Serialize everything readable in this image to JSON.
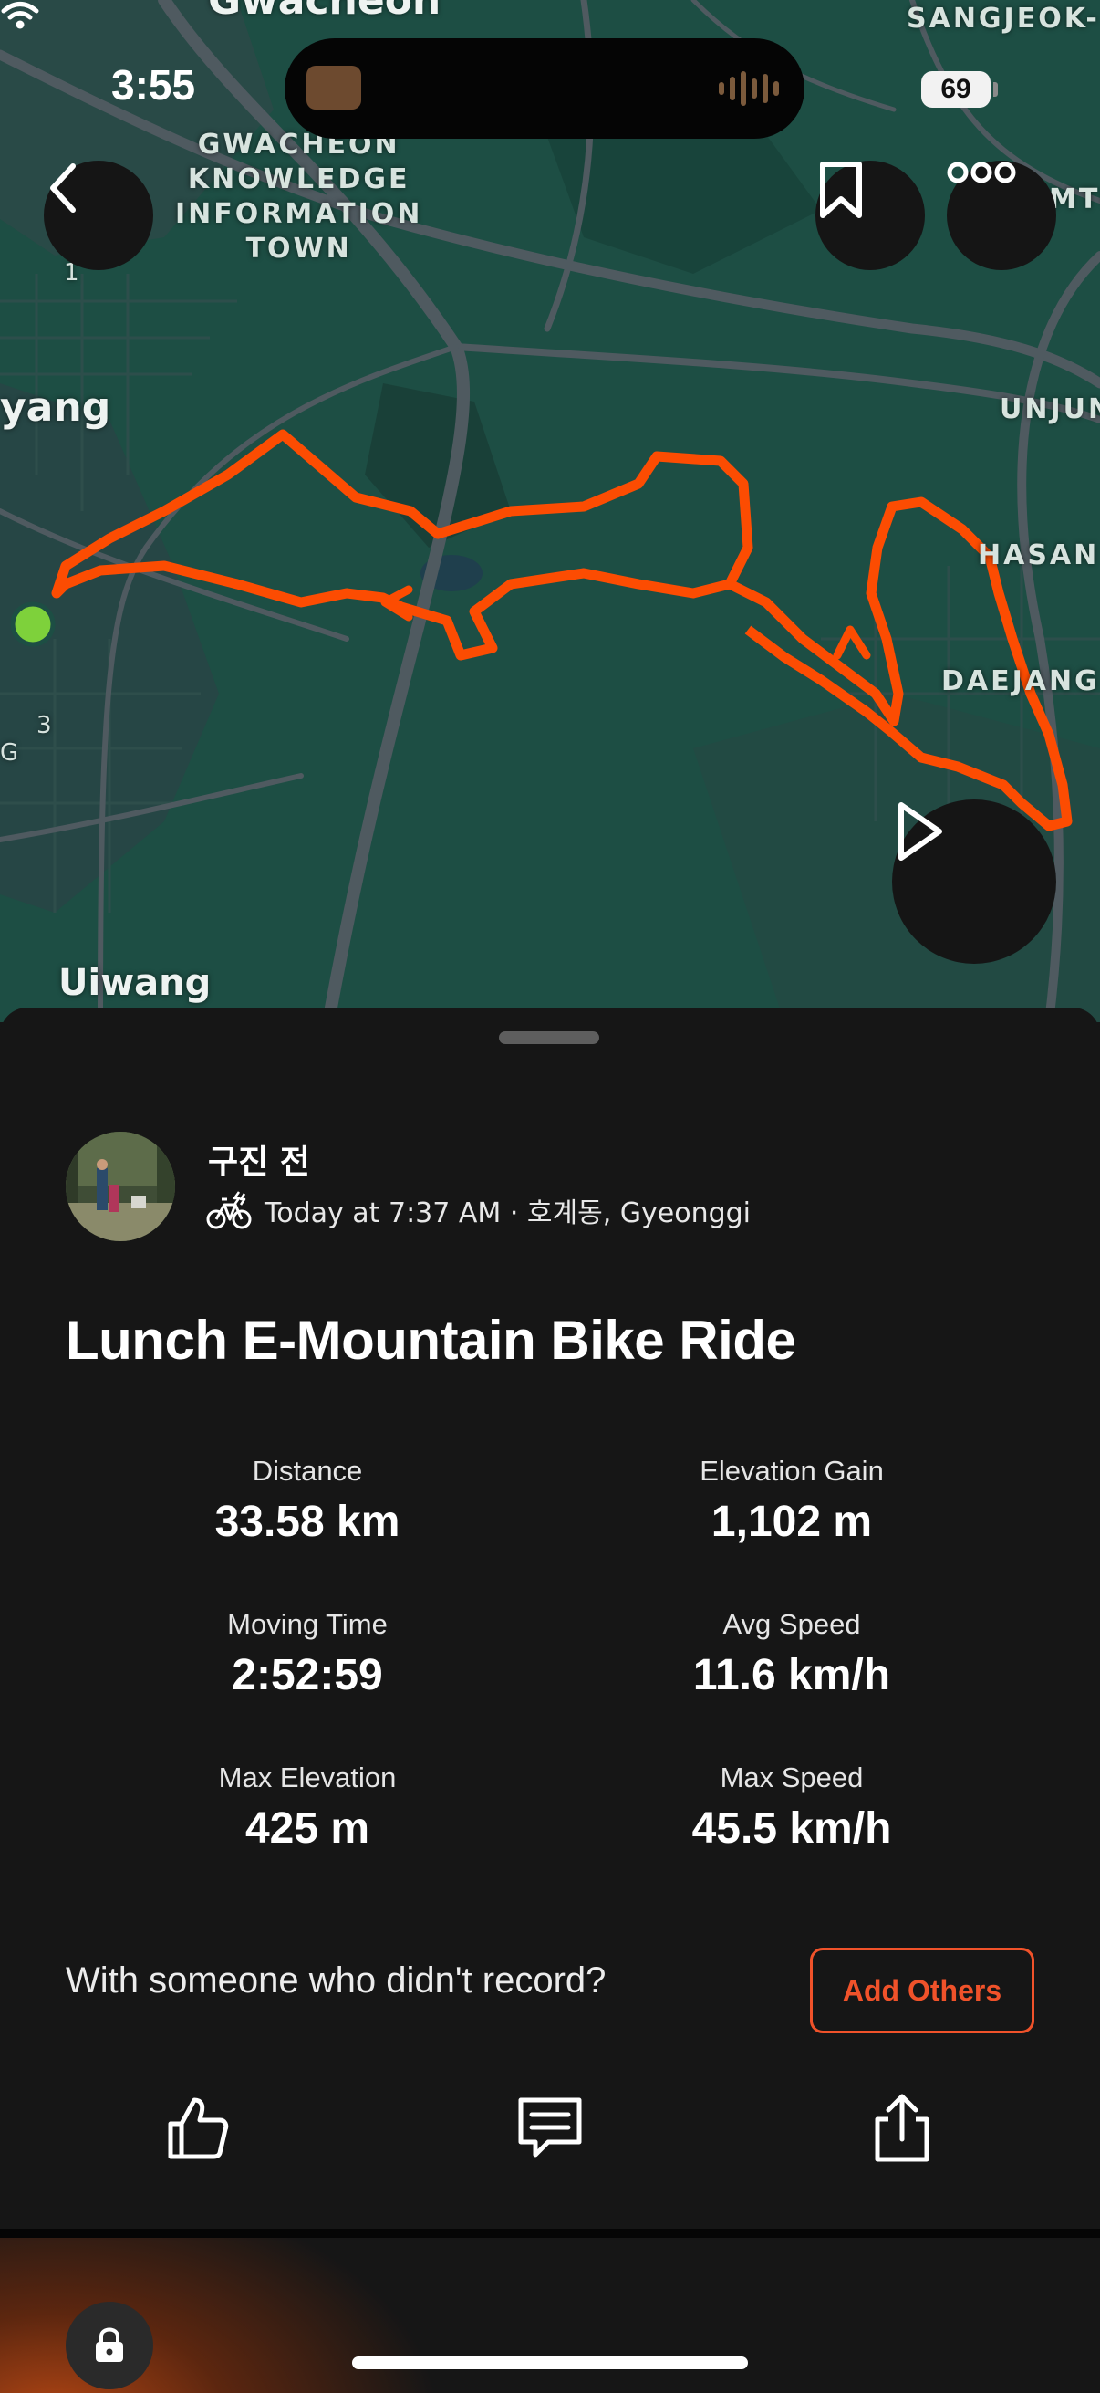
{
  "status_bar": {
    "time": "3:55",
    "battery": "69"
  },
  "map": {
    "labels": {
      "gwacheon": "Gwacheon",
      "knowledge_town": "GWACHEON\nKNOWLEDGE\nINFORMATION\nTOWN",
      "sangjeok": "SANGJEOK-",
      "mto": "MTO",
      "anyang": "yang",
      "unjung": "UNJUN",
      "hasan": "HASAN",
      "daejang": "DAEJANG",
      "uiwang": "Uiwang",
      "route_1": "1",
      "route_3": "3",
      "edge_g": "G"
    },
    "route_color": "#fc4c02",
    "start_marker_color": "#7ed13b"
  },
  "activity": {
    "athlete_name": "구진 전",
    "meta": "Today at 7:37 AM · 호계동, Gyeonggi",
    "title": "Lunch E-Mountain Bike Ride",
    "stats": [
      {
        "label": "Distance",
        "value": "33.58 km"
      },
      {
        "label": "Elevation Gain",
        "value": "1,102 m"
      },
      {
        "label": "Moving Time",
        "value": "2:52:59"
      },
      {
        "label": "Avg Speed",
        "value": "11.6 km/h"
      },
      {
        "label": "Max Elevation",
        "value": "425 m"
      },
      {
        "label": "Max Speed",
        "value": "45.5 km/h"
      }
    ]
  },
  "prompt": {
    "text": "With someone who didn't record?",
    "button": "Add Others"
  },
  "colors": {
    "accent": "#f0522a",
    "background": "#161616"
  },
  "icons": {
    "back": "chevron-left-icon",
    "bookmark": "bookmark-icon",
    "more": "more-options-icon",
    "play": "play-icon",
    "kudos": "thumbs-up-icon",
    "comment": "comment-icon",
    "share": "share-icon",
    "sport": "e-bike-icon",
    "lock": "lock-icon"
  }
}
